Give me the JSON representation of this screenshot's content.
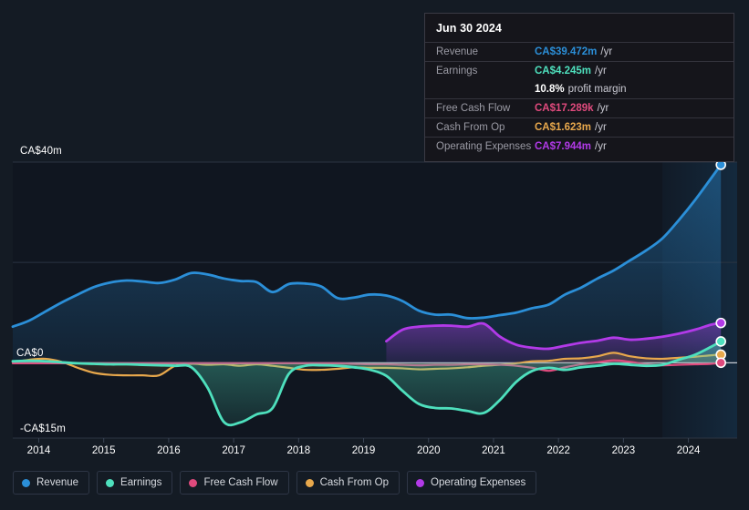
{
  "tooltip": {
    "date": "Jun 30 2024",
    "rows": [
      {
        "key": "Revenue",
        "value": "CA$39.472m",
        "unit": "/yr",
        "color": "#2b8fd8"
      },
      {
        "key": "Earnings",
        "value": "CA$4.245m",
        "unit": "/yr",
        "color": "#4ee0bd"
      },
      {
        "key": "",
        "value": "10.8%",
        "unit": "profit margin",
        "color": "#ffffff",
        "margin": true
      },
      {
        "key": "Free Cash Flow",
        "value": "CA$17.289k",
        "unit": "/yr",
        "color": "#e04a7d"
      },
      {
        "key": "Cash From Op",
        "value": "CA$1.623m",
        "unit": "/yr",
        "color": "#e8a84c"
      },
      {
        "key": "Operating Expenses",
        "value": "CA$7.944m",
        "unit": "/yr",
        "color": "#b23ae8"
      }
    ]
  },
  "legend": [
    {
      "label": "Revenue",
      "color": "#2b8fd8"
    },
    {
      "label": "Earnings",
      "color": "#4ee0bd"
    },
    {
      "label": "Free Cash Flow",
      "color": "#e04a7d"
    },
    {
      "label": "Cash From Op",
      "color": "#e8a84c"
    },
    {
      "label": "Operating Expenses",
      "color": "#b23ae8"
    }
  ],
  "chart_data": {
    "type": "line",
    "title": "",
    "xlabel": "",
    "ylabel": "",
    "currency": "CA$",
    "units": "millions",
    "xlim": [
      2013.6,
      2024.75
    ],
    "ylim": [
      -15,
      40
    ],
    "grid": true,
    "y_ticks": [
      {
        "value": 40,
        "label": "CA$40m"
      },
      {
        "value": 20,
        "label": ""
      },
      {
        "value": 0,
        "label": "CA$0"
      },
      {
        "value": -15,
        "label": "-CA$15m"
      }
    ],
    "x_ticks": [
      2014,
      2015,
      2016,
      2017,
      2018,
      2019,
      2020,
      2021,
      2022,
      2023,
      2024
    ],
    "forecast_start": 2023.6,
    "x": [
      2013.6,
      2013.85,
      2014.1,
      2014.35,
      2014.6,
      2014.85,
      2015.1,
      2015.35,
      2015.6,
      2015.85,
      2016.1,
      2016.35,
      2016.6,
      2016.85,
      2017.1,
      2017.35,
      2017.6,
      2017.85,
      2018.1,
      2018.35,
      2018.6,
      2018.85,
      2019.1,
      2019.35,
      2019.6,
      2019.85,
      2020.1,
      2020.35,
      2020.6,
      2020.85,
      2021.1,
      2021.35,
      2021.6,
      2021.85,
      2022.1,
      2022.35,
      2022.6,
      2022.85,
      2023.1,
      2023.35,
      2023.6,
      2023.85,
      2024.1,
      2024.35,
      2024.5
    ],
    "series": [
      {
        "name": "Revenue",
        "color": "#2b8fd8",
        "values": [
          7.2,
          8.4,
          10.2,
          12.0,
          13.6,
          15.1,
          16.0,
          16.4,
          16.2,
          15.9,
          16.6,
          17.9,
          17.6,
          16.8,
          16.3,
          16.1,
          14.1,
          15.7,
          15.8,
          15.2,
          12.9,
          13.0,
          13.6,
          13.4,
          12.3,
          10.4,
          9.6,
          9.6,
          8.9,
          9.0,
          9.5,
          10.0,
          10.9,
          11.6,
          13.6,
          15.0,
          16.8,
          18.4,
          20.4,
          22.4,
          24.8,
          28.4,
          32.4,
          36.8,
          39.47
        ]
      },
      {
        "name": "Earnings",
        "color": "#4ee0bd",
        "values": [
          0.3,
          0.4,
          0.3,
          0.1,
          -0.1,
          -0.2,
          -0.3,
          -0.3,
          -0.4,
          -0.5,
          -0.6,
          -0.9,
          -5.0,
          -11.8,
          -11.9,
          -10.3,
          -9.0,
          -2.2,
          -0.6,
          -0.5,
          -0.6,
          -0.9,
          -1.4,
          -2.6,
          -5.6,
          -8.2,
          -9.0,
          -9.1,
          -9.6,
          -10.0,
          -7.4,
          -3.8,
          -1.6,
          -1.0,
          -1.4,
          -0.9,
          -0.6,
          -0.2,
          -0.4,
          -0.6,
          -0.4,
          0.6,
          1.6,
          3.2,
          4.25
        ]
      },
      {
        "name": "Free Cash Flow",
        "color": "#e04a7d",
        "values": [
          -0.1,
          -0.1,
          -0.1,
          -0.1,
          -0.1,
          -0.1,
          -0.1,
          -0.1,
          -0.1,
          -0.1,
          -0.1,
          -0.1,
          -0.1,
          -0.1,
          -0.1,
          -0.1,
          -0.1,
          -0.1,
          -0.1,
          -0.1,
          -0.1,
          -0.2,
          -0.3,
          -0.3,
          -0.4,
          -0.5,
          -0.4,
          -0.4,
          -0.3,
          -0.3,
          -0.4,
          -0.6,
          -1.0,
          -1.6,
          -0.9,
          -0.3,
          0.1,
          0.5,
          0.2,
          -0.3,
          -0.5,
          -0.4,
          -0.3,
          -0.2,
          0.017
        ]
      },
      {
        "name": "Cash From Op",
        "color": "#e8a84c",
        "values": [
          0.1,
          0.6,
          0.8,
          0.2,
          -1.0,
          -2.0,
          -2.4,
          -2.5,
          -2.5,
          -2.5,
          -0.6,
          -0.2,
          -0.4,
          -0.3,
          -0.6,
          -0.3,
          -0.6,
          -1.0,
          -1.4,
          -1.4,
          -1.2,
          -0.9,
          -1.0,
          -1.0,
          -1.1,
          -1.3,
          -1.2,
          -1.1,
          -0.9,
          -0.6,
          -0.4,
          -0.1,
          0.3,
          0.4,
          0.8,
          0.9,
          1.3,
          2.0,
          1.3,
          0.9,
          0.8,
          1.0,
          1.2,
          1.5,
          1.62
        ]
      },
      {
        "name": "Operating Expenses",
        "color": "#b23ae8",
        "values": [
          null,
          null,
          null,
          null,
          null,
          null,
          null,
          null,
          null,
          null,
          null,
          null,
          null,
          null,
          null,
          null,
          null,
          null,
          null,
          null,
          null,
          null,
          null,
          4.3,
          6.6,
          7.2,
          7.4,
          7.4,
          7.2,
          7.8,
          5.2,
          3.6,
          3.0,
          2.8,
          3.4,
          4.0,
          4.4,
          5.0,
          4.6,
          4.8,
          5.2,
          5.8,
          6.6,
          7.6,
          7.94
        ]
      }
    ]
  }
}
